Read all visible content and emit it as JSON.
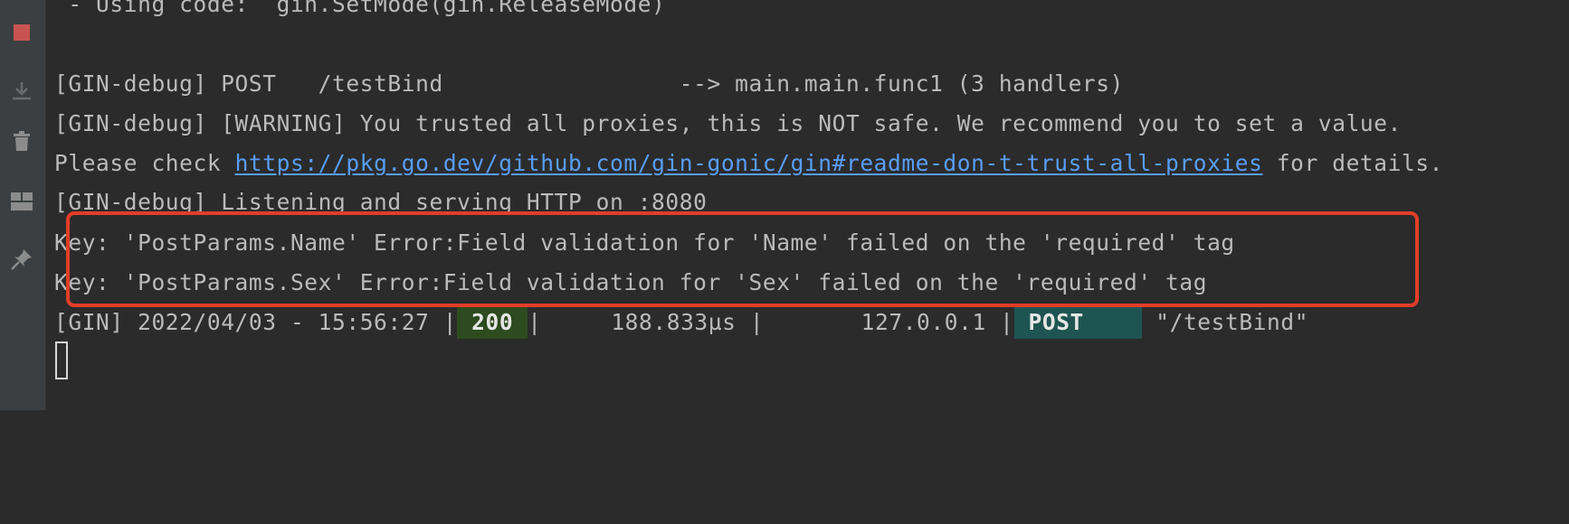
{
  "toolbar": {
    "icons": [
      "stop-icon",
      "scroll-to-end-icon",
      "trash-icon",
      "layout-icon",
      "pin-icon"
    ],
    "colors": {
      "stop": "#c75450",
      "icon": "#8c8c8c"
    }
  },
  "console": {
    "line_top_partial": " - Using code:  gin.SetMode(gin.ReleaseMode)",
    "line_route": "[GIN-debug] POST   /testBind                 --> main.main.func1 (3 handlers)",
    "line_warning": "[GIN-debug] [WARNING] You trusted all proxies, this is NOT safe. We recommend you to set a value.",
    "line_check_prefix": "Please check ",
    "line_check_link": "https://pkg.go.dev/github.com/gin-gonic/gin#readme-don-t-trust-all-proxies",
    "line_check_suffix": " for details.",
    "line_listening": "[GIN-debug] Listening and serving HTTP on :8080",
    "error_lines": [
      "Key: 'PostParams.Name' Error:Field validation for 'Name' failed on the 'required' tag",
      "Key: 'PostParams.Sex' Error:Field validation for 'Sex' failed on the 'required' tag"
    ],
    "request_log": {
      "prefix": "[GIN] 2022/04/03 - 15:56:27 |",
      "status": "200",
      "latency": "|     188.833µs |       127.0.0.1 |",
      "method": "POST",
      "path": " \"/testBind\""
    }
  },
  "colors": {
    "background": "#2b2b2b",
    "text": "#bbbbbb",
    "link": "#589df6",
    "highlight_box": "#e23d28",
    "status_ok_bg": "#2d4b1e",
    "method_bg": "#1e5552"
  }
}
